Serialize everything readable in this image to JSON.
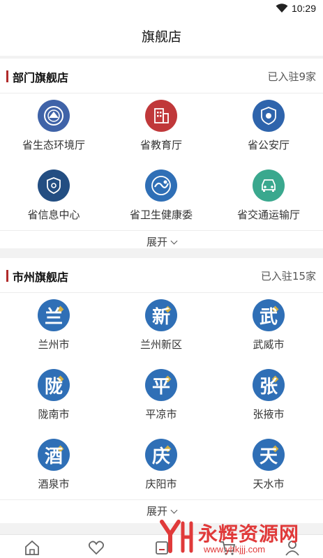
{
  "status_bar": {
    "time": "10:29"
  },
  "header": {
    "title": "旗舰店"
  },
  "dept_section": {
    "title": "部门旗舰店",
    "count": "已入驻9家",
    "items": [
      {
        "label": "省生态环境厅",
        "icon": "ministry-emblem-icon",
        "color": "#3f63a8"
      },
      {
        "label": "省教育厅",
        "icon": "building-icon",
        "color": "#c0383a"
      },
      {
        "label": "省公安厅",
        "icon": "police-badge-icon",
        "color": "#2e64ac"
      },
      {
        "label": "省信息中心",
        "icon": "shield-icon",
        "color": "#234e82"
      },
      {
        "label": "省卫生健康委",
        "icon": "health-logo-icon",
        "color": "#2f6fb6"
      },
      {
        "label": "省交通运输厅",
        "icon": "car-icon",
        "color": "#3aa88e"
      }
    ],
    "expand_label": "展开"
  },
  "city_section": {
    "title": "市州旗舰店",
    "count": "已入驻15家",
    "items": [
      {
        "label": "兰州市",
        "char": "兰"
      },
      {
        "label": "兰州新区",
        "char": "新"
      },
      {
        "label": "武威市",
        "char": "武"
      },
      {
        "label": "陇南市",
        "char": "陇"
      },
      {
        "label": "平凉市",
        "char": "平"
      },
      {
        "label": "张掖市",
        "char": "张"
      },
      {
        "label": "酒泉市",
        "char": "酒"
      },
      {
        "label": "庆阳市",
        "char": "庆"
      },
      {
        "label": "天水市",
        "char": "天"
      }
    ],
    "expand_label": "展开"
  },
  "bottom_nav": {
    "items": [
      {
        "icon": "home-icon"
      },
      {
        "icon": "heart-icon"
      },
      {
        "icon": "store-icon"
      },
      {
        "icon": "cart-icon"
      },
      {
        "icon": "user-icon"
      }
    ]
  },
  "watermark": {
    "text": "永辉资源网",
    "url": "www.yhkjjj.com"
  }
}
